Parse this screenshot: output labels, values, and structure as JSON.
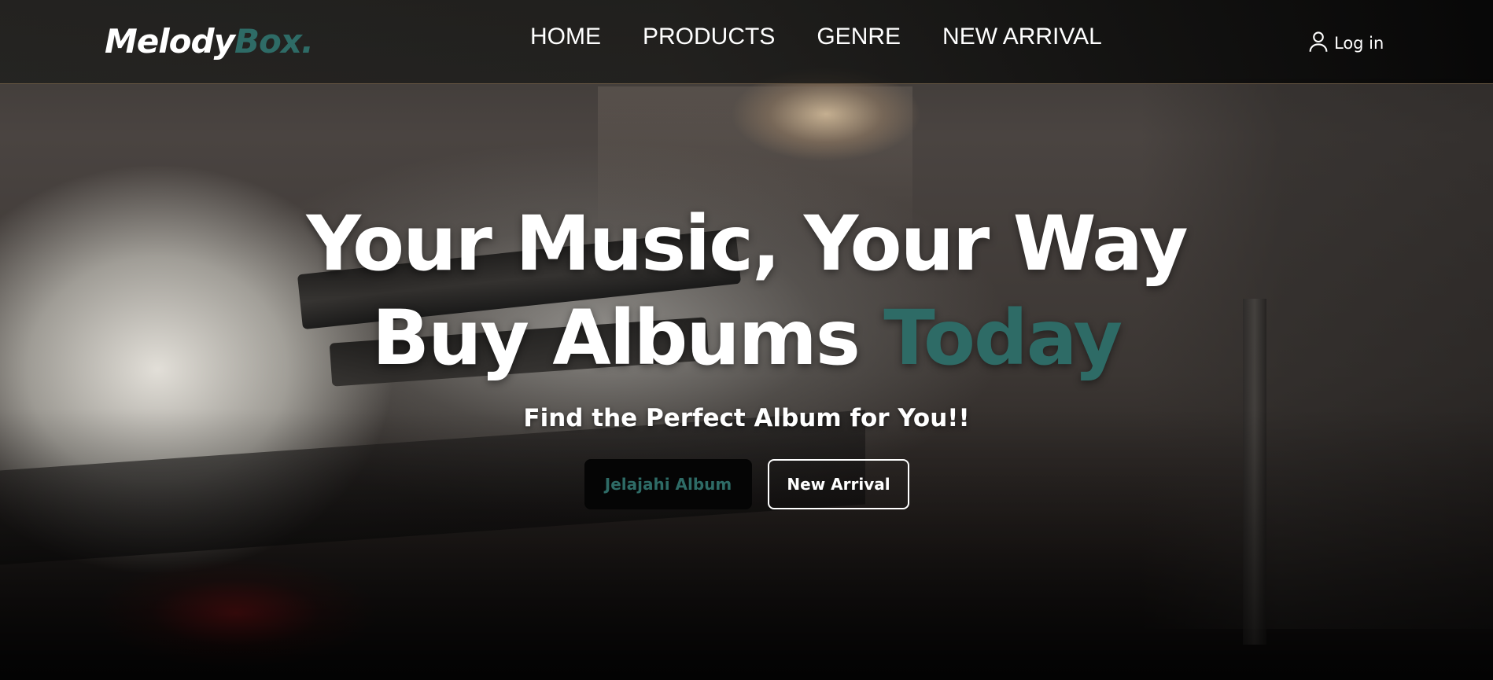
{
  "brand": {
    "name_main": "Melody",
    "name_accent": "Box.",
    "accent_color": "#2e6b66"
  },
  "nav": {
    "items": [
      {
        "label": "HOME"
      },
      {
        "label": "PRODUCTS"
      },
      {
        "label": "GENRE"
      },
      {
        "label": "NEW ARRIVAL"
      }
    ],
    "login_label": "Log in",
    "login_icon": "user-icon"
  },
  "hero": {
    "line1": "Your Music, Your Way",
    "line2_main": "Buy Albums ",
    "line2_accent": "Today",
    "subtitle": "Find the Perfect Album for You!!",
    "primary_button": "Jelajahi Album",
    "secondary_button": "New Arrival"
  }
}
